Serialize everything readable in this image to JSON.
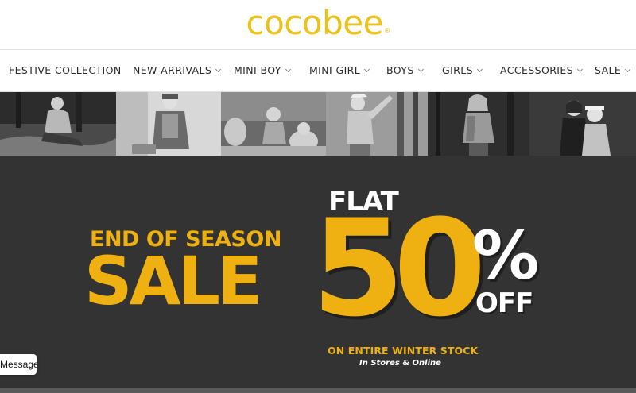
{
  "brand": {
    "logo_text": "cocobee",
    "registered_mark": "®",
    "color": "#ecc11a"
  },
  "nav": {
    "items": [
      {
        "label": "FESTIVE COLLECTION",
        "has_dropdown": false
      },
      {
        "label": "NEW ARRIVALS",
        "has_dropdown": true
      },
      {
        "label": "MINI BOY",
        "has_dropdown": true
      },
      {
        "label": "MINI GIRL",
        "has_dropdown": true
      },
      {
        "label": "BOYS",
        "has_dropdown": true
      },
      {
        "label": "GIRLS",
        "has_dropdown": true
      },
      {
        "label": "ACCESSORIES",
        "has_dropdown": true
      },
      {
        "label": "SALE",
        "has_dropdown": true
      }
    ]
  },
  "banner": {
    "line1": "END OF SEASON",
    "line2": "SALE",
    "flat": "FLAT",
    "discount": "50",
    "percent_sign": "%",
    "off": "OFF",
    "subline": "ON ENTIRE WINTER STOCK",
    "availability": "In Stores & Online",
    "accent_color": "#efb111",
    "background_color": "#333333"
  },
  "chat_widget": {
    "label": "Message us"
  }
}
